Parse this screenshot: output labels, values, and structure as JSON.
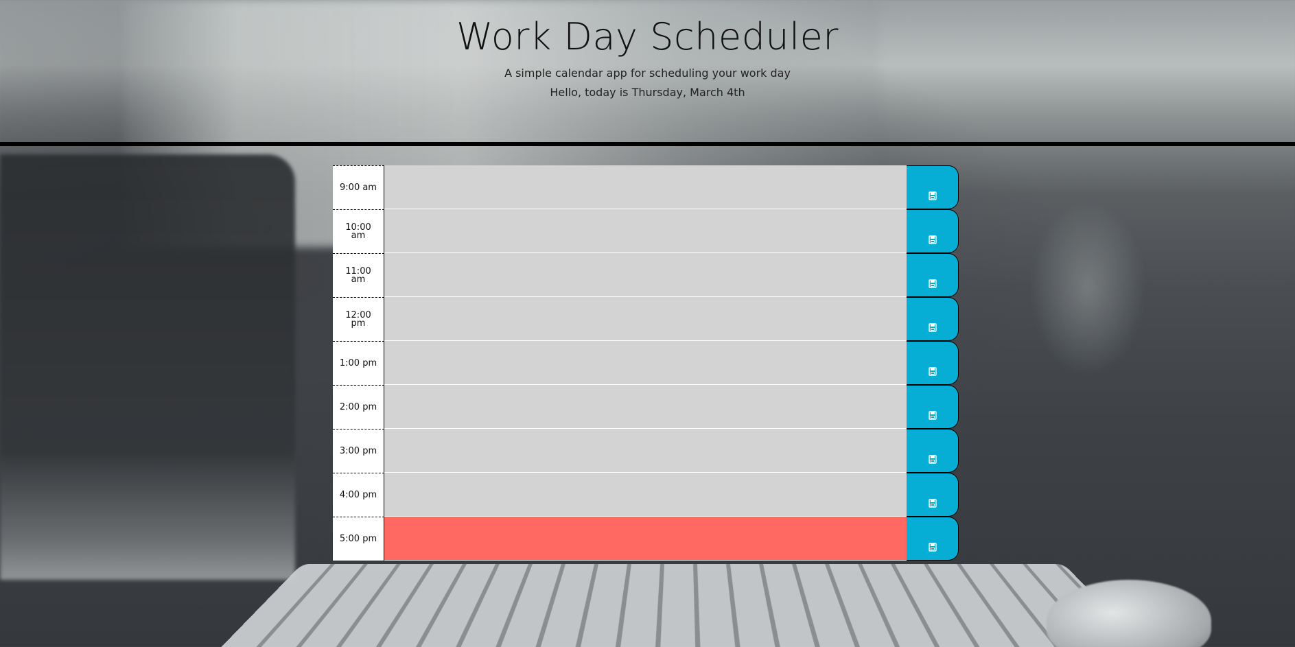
{
  "header": {
    "title": "Work Day Scheduler",
    "subtitle": "A simple calendar app for scheduling your work day",
    "today": "Hello, today is Thursday, March 4th"
  },
  "time_blocks": [
    {
      "hour": "9:00 am",
      "text": "",
      "state": "past"
    },
    {
      "hour": "10:00 am",
      "text": "",
      "state": "past"
    },
    {
      "hour": "11:00 am",
      "text": "",
      "state": "past"
    },
    {
      "hour": "12:00 pm",
      "text": "",
      "state": "past"
    },
    {
      "hour": "1:00 pm",
      "text": "",
      "state": "past"
    },
    {
      "hour": "2:00 pm",
      "text": "",
      "state": "past"
    },
    {
      "hour": "3:00 pm",
      "text": "",
      "state": "past"
    },
    {
      "hour": "4:00 pm",
      "text": "",
      "state": "past"
    },
    {
      "hour": "5:00 pm",
      "text": "",
      "state": "present"
    }
  ],
  "save_icon": "save-icon",
  "colors": {
    "past": "#d3d3d3",
    "present": "#ff6961",
    "save_button": "#06aed5"
  }
}
